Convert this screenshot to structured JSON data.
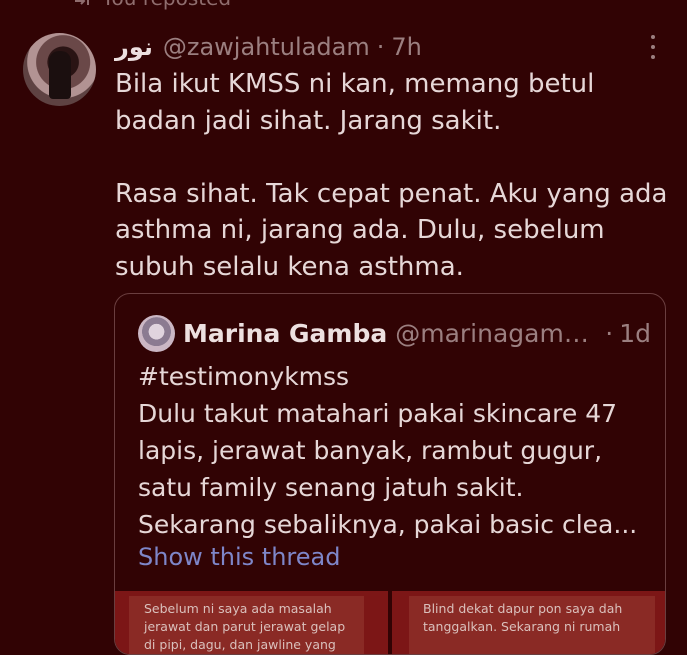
{
  "repost": {
    "label": "You reposted"
  },
  "post": {
    "author_name": "نور",
    "handle": "@zawjahtuladam",
    "time": "7h",
    "text": "Bila ikut KMSS ni kan, memang betul badan jadi sihat. Jarang sakit.\n\nRasa sihat. Tak cepat penat. Aku yang ada asthma ni, jarang ada. Dulu, sebelum subuh selalu kena asthma."
  },
  "quote": {
    "author_name": "Marina Gamba",
    "handle": "@marinagamb...",
    "time": "1d",
    "lines": [
      "#testimonykmss",
      "Dulu takut matahari pakai skincare 47",
      "lapis, jerawat banyak, rambut gugur,",
      "satu family senang jatuh sakit.",
      "Sekarang sebaliknya, pakai basic clea..."
    ],
    "show_thread": "Show this thread",
    "media": [
      {
        "lines": [
          "Sebelum ni saya ada masalah",
          "jerawat dan parut jerawat gelap",
          "di pipi, dagu, dan jawline yang"
        ]
      },
      {
        "lines": [
          "Blind dekat dapur pon saya dah",
          "tanggalkan. Sekarang ni rumah"
        ]
      }
    ]
  }
}
